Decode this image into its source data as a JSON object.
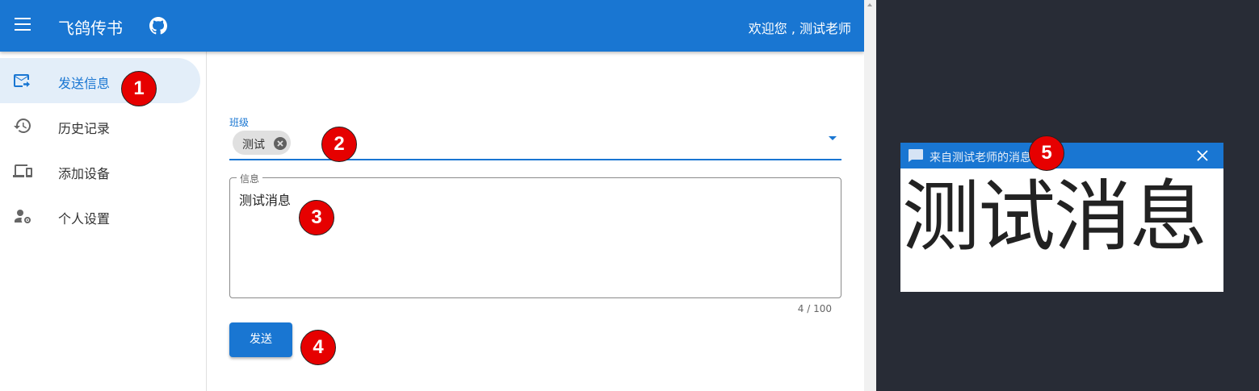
{
  "appbar": {
    "title": "飞鸽传书",
    "welcome": "欢迎您 , 测试老师"
  },
  "sidebar": {
    "items": [
      {
        "label": "发送信息",
        "icon": "send-mail-icon",
        "active": true
      },
      {
        "label": "历史记录",
        "icon": "history-icon",
        "active": false
      },
      {
        "label": "添加设备",
        "icon": "devices-icon",
        "active": false
      },
      {
        "label": "个人设置",
        "icon": "person-settings-icon",
        "active": false
      }
    ]
  },
  "form": {
    "class_label": "班级",
    "class_chip": "测试",
    "message_label": "信息",
    "message_value": "测试消息",
    "counter": "4 / 100",
    "send_label": "发送"
  },
  "notification": {
    "title": "来自测试老师的消息",
    "body": "测试消息"
  },
  "badges": [
    "1",
    "2",
    "3",
    "4",
    "5"
  ],
  "colors": {
    "primary": "#1976d2",
    "active_bg": "#e3eef9",
    "badge": "#e60000",
    "desktop": "#282c36"
  }
}
